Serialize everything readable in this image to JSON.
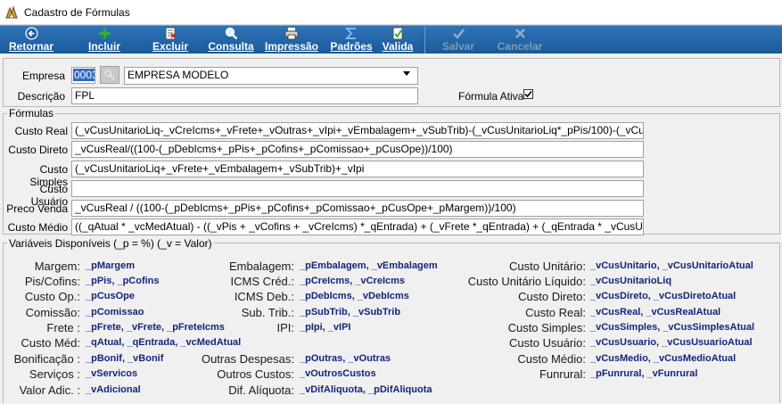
{
  "window": {
    "title": "Cadastro de Fórmulas"
  },
  "toolbar": {
    "buttons": [
      {
        "label": "Retornar",
        "icon": "back-arrow-icon",
        "enabled": true
      },
      {
        "label": "Incluir",
        "icon": "plus-icon",
        "enabled": true
      },
      {
        "label": "Excluir",
        "icon": "delete-document-icon",
        "enabled": true
      },
      {
        "label": "Consulta",
        "icon": "search-icon",
        "enabled": true
      },
      {
        "label": "Impressão",
        "icon": "printer-icon",
        "enabled": true
      },
      {
        "label": "Padrões",
        "icon": "sigma-icon",
        "enabled": true
      },
      {
        "label": "Valida",
        "icon": "validate-icon",
        "enabled": true
      },
      {
        "label": "Salvar",
        "icon": "check-icon",
        "enabled": false
      },
      {
        "label": "Cancelar",
        "icon": "x-icon",
        "enabled": false
      }
    ]
  },
  "header": {
    "empresa_label": "Empresa",
    "empresa_code": "0003",
    "empresa_name": "EMPRESA MODELO",
    "descricao_label": "Descrição",
    "descricao_value": "FPL",
    "formula_ativa_label": "Fórmula Ativa",
    "formula_ativa_checked": true
  },
  "formulas": {
    "legend": "Fórmulas",
    "rows": [
      {
        "label": "Custo Real",
        "value": "(_vCusUnitarioLiq-_vCreIcms+_vFrete+_vOutras+_vIpi+_vEmbalagem+_vSubTrib)-(_vCusUnitarioLiq*_pPis/100)-(_vCusUnitarioLiq*"
      },
      {
        "label": "Custo Direto",
        "value": "_vCusReal/((100-(_pDebIcms+_pPis+_pCofins+_pComissao+_pCusOpe))/100)"
      },
      {
        "label": "Custo Simples",
        "value": "(_vCusUnitarioLiq+_vFrete+_vEmbalagem+_vSubTrib)+_vIpi"
      },
      {
        "label": "Custo Usuário",
        "value": ""
      },
      {
        "label": "Preco Venda",
        "value": "_vCusReal / ((100-(_pDebIcms+_pPis+_pCofins+_pComissao+_pCusOpe+_pMargem))/100)"
      },
      {
        "label": "Custo Médio",
        "value": "((_qAtual * _vcMedAtual) - ((_vPis + _vCofins + _vCreIcms) *_qEntrada) + (_vFrete *_qEntrada) + (_qEntrada * _vCusUnitarioLiq))"
      }
    ]
  },
  "variables": {
    "legend": "Variáveis Disponíveis (_p = %) (_v = Valor)",
    "col1": [
      {
        "label": "Margem:",
        "value": "_pMargem"
      },
      {
        "label": "Pis/Cofins:",
        "value": "_pPis, _pCofins"
      },
      {
        "label": "Custo Op.:",
        "value": "_pCusOpe"
      },
      {
        "label": "Comissão:",
        "value": "_pComissao"
      },
      {
        "label": "Frete :",
        "value": "_pFrete, _vFrete, _pFreteIcms"
      },
      {
        "label": "Custo Méd:",
        "value": "_qAtual, _qEntrada, _vcMedAtual"
      },
      {
        "label": "Bonificação :",
        "value": "_pBonif, _vBonif"
      },
      {
        "label": "Serviços :",
        "value": "_vServicos"
      },
      {
        "label": "Valor Adic. :",
        "value": "_vAdicional"
      }
    ],
    "col2": [
      {
        "label": "Embalagem:",
        "value": "_pEmbalagem, _vEmbalagem"
      },
      {
        "label": "ICMS Créd.:",
        "value": "_pCreIcms, _vCreIcms"
      },
      {
        "label": "ICMS Deb.:",
        "value": "_pDebIcms, _vDebIcms"
      },
      {
        "label": "Sub. Trib.:",
        "value": "_pSubTrib, _vSubTrib"
      },
      {
        "label": "IPI:",
        "value": "_pIpi, _vIPI"
      },
      {
        "label": "Outras Despesas:",
        "value": "_pOutras, _vOutras"
      },
      {
        "label": "Outros Custos:",
        "value": "_vOutrosCustos"
      },
      {
        "label": "Dif. Alíquota:",
        "value": "_vDifAliquota, _pDifAliquota"
      }
    ],
    "col3": [
      {
        "label": "Custo Unitário:",
        "value": "_vCusUnitario, _vCusUnitarioAtual"
      },
      {
        "label": "Custo Unitário Líquido:",
        "value": "_vCusUnitarioLiq"
      },
      {
        "label": "Custo Direto:",
        "value": "_vCusDireto, _vCusDiretoAtual"
      },
      {
        "label": "Custo Real:",
        "value": "_vCusReal, _vCusRealAtual"
      },
      {
        "label": "Custo Simples:",
        "value": "_vCusSimples, _vCusSimplesAtual"
      },
      {
        "label": "Custo Usuário:",
        "value": "_vCusUsuario, _vCusUsuarioAtual"
      },
      {
        "label": "Custo Médio:",
        "value": "_vCusMedio, _vCusMedioAtual"
      },
      {
        "label": "Funrural:",
        "value": "_pFunrural, _vFunrural"
      }
    ]
  }
}
